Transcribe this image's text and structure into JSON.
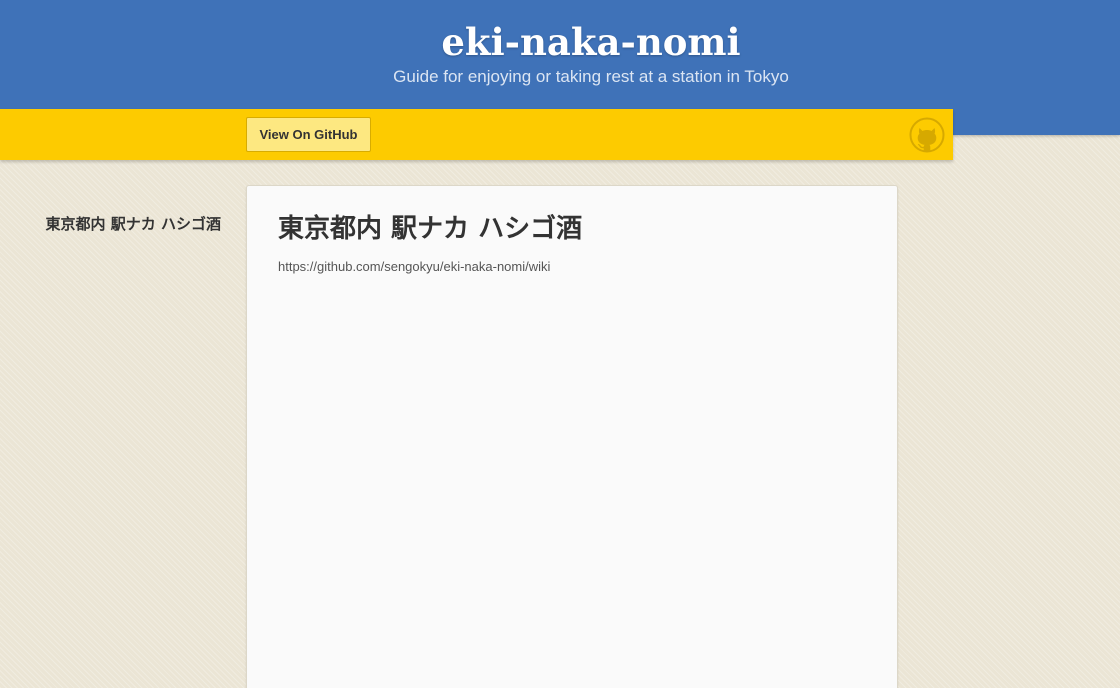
{
  "header": {
    "title": "eki-naka-nomi",
    "tagline": "Guide for enjoying or taking rest at a station in Tokyo"
  },
  "banner": {
    "github_button_label": "View On GitHub",
    "github_icon": "github-octocat-icon"
  },
  "sidebar": {
    "title": "東京都内 駅ナカ ハシゴ酒"
  },
  "main": {
    "title": "東京都内 駅ナカ ハシゴ酒",
    "link_text": "https://github.com/sengokyu/eki-naka-nomi/wiki"
  },
  "colors": {
    "header_blue": "#3f72b8",
    "banner_yellow": "#fdcb00",
    "button_yellow": "#fde881",
    "page_background": "#ebe5d5",
    "card_background": "#fafafa",
    "text_dark": "#333333"
  }
}
